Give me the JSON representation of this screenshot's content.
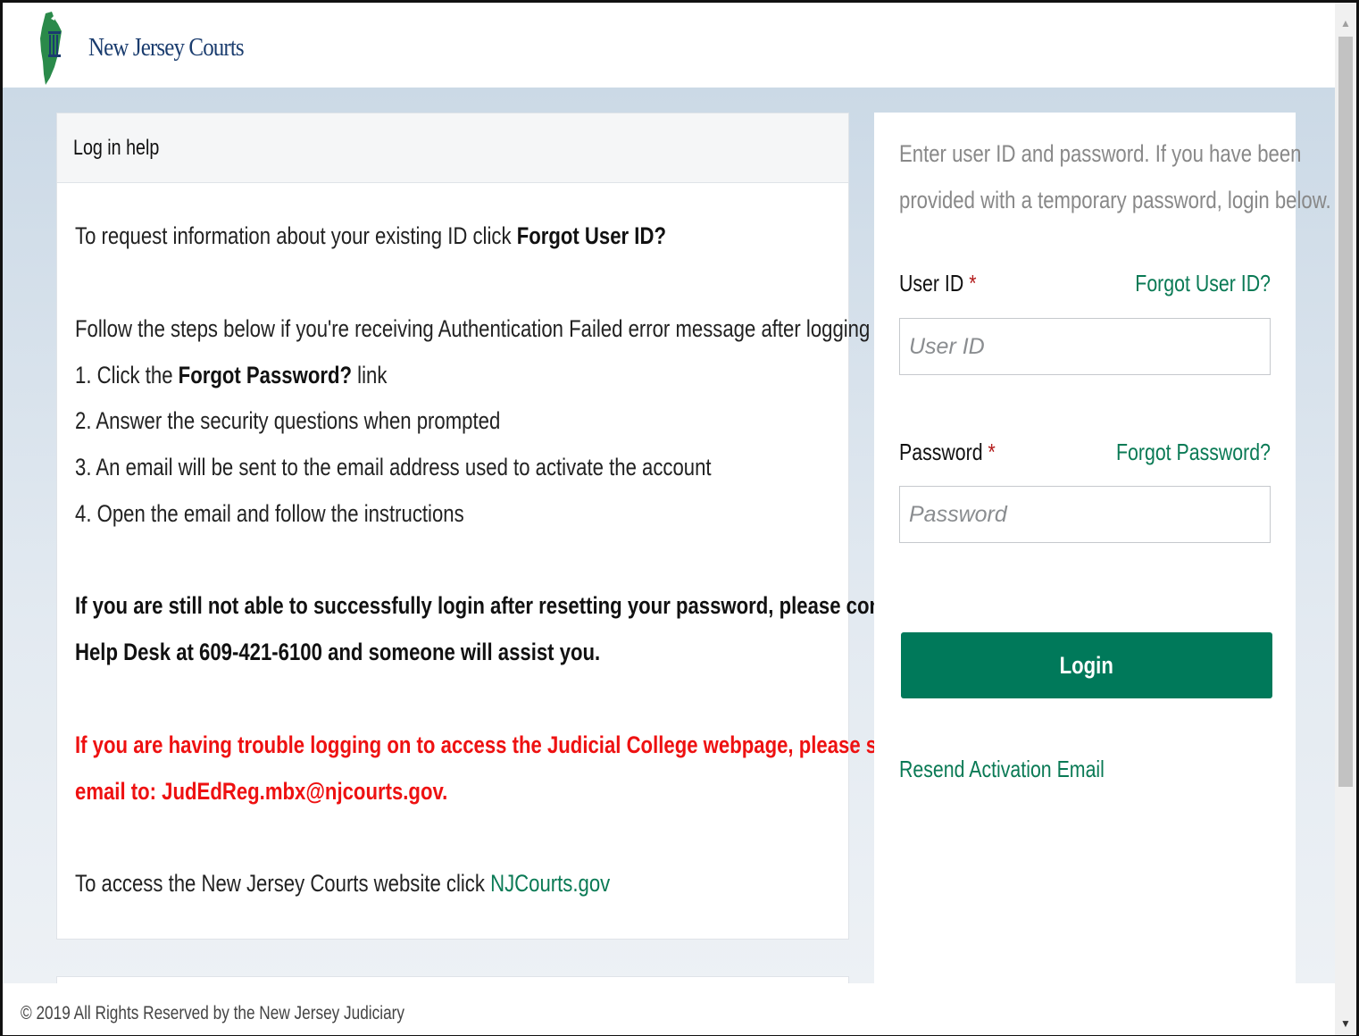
{
  "header": {
    "logo_text": "New Jersey Courts"
  },
  "help": {
    "title": "Log in help",
    "intro_prefix": "To request information about your existing ID click ",
    "intro_bold": "Forgot User ID?",
    "steps_intro": "Follow the steps below if you're receiving Authentication Failed error message after logging in.",
    "step1_prefix": "1. Click the ",
    "step1_bold": "Forgot Password?",
    "step1_suffix": " link",
    "step2": "2. Answer the security questions when prompted",
    "step3": "3. An email will be sent to the email address used to activate the account",
    "step4": "4. Open the email and follow the instructions",
    "contact_line1": "If you are still not able to successfully login after resetting your password, please contact the",
    "contact_line2": "Help Desk at 609-421-6100 and someone will assist you.",
    "judicial_line1": "If you are having trouble logging on to access the Judicial College webpage, please send an",
    "judicial_line2": "email to: JudEdReg.mbx@njcourts.gov.",
    "website_prefix": "To access the New Jersey Courts website click ",
    "website_link": "NJCourts.gov"
  },
  "login": {
    "intro_line1": "Enter user ID and password. If you have been",
    "intro_line2": "provided with a temporary password, login below.",
    "userid_label": "User ID",
    "userid_required": "*",
    "forgot_userid": "Forgot User ID?",
    "userid_placeholder": "User ID",
    "password_label": "Password",
    "password_required": "*",
    "forgot_password": "Forgot Password?",
    "password_placeholder": "Password",
    "login_button": "Login",
    "resend_activation": "Resend Activation Email"
  },
  "footer": {
    "copyright": "© 2019 All Rights Reserved by the New Jersey Judiciary"
  },
  "colors": {
    "accent_green": "#00795a",
    "link_green": "#0a7a55",
    "alert_red": "#ee1111",
    "required_red": "#b31b1b"
  },
  "icons": {
    "logo": "nj-courts-logo-icon",
    "scroll_up": "scroll-up-arrow-icon",
    "scroll_down": "scroll-down-arrow-icon"
  }
}
